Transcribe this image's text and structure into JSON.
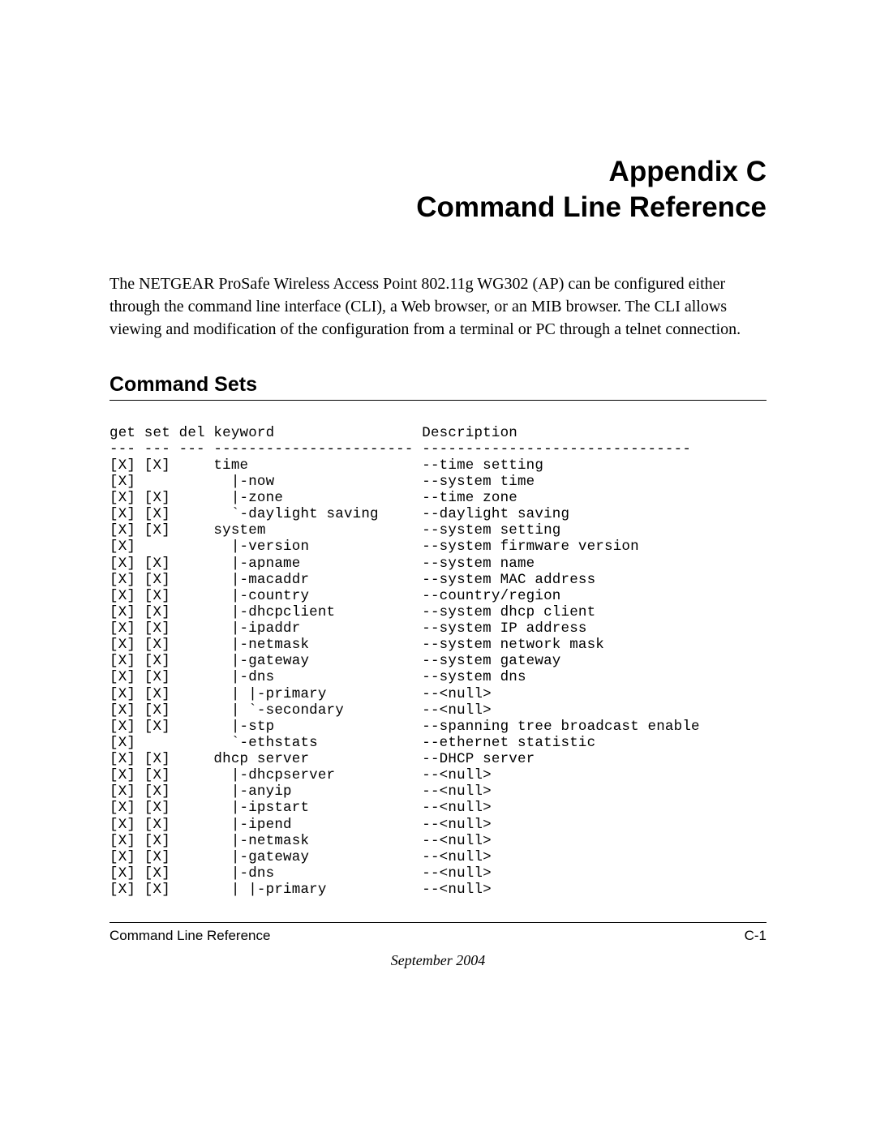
{
  "title_line1": "Appendix C",
  "title_line2": "Command Line Reference",
  "intro": "The NETGEAR ProSafe Wireless Access Point 802.11g WG302  (AP) can be configured either through the command line interface (CLI), a Web browser, or an MIB browser. The CLI allows viewing and modification of the configuration from a terminal or PC through a telnet connection.",
  "section_heading": "Command Sets",
  "footer_left": "Command Line Reference",
  "footer_right": "C-1",
  "footer_date": "September 2004",
  "table": {
    "header": {
      "get": "get",
      "set": "set",
      "del": "del",
      "keyword": "keyword",
      "description": "Description"
    },
    "divider": {
      "get": "---",
      "set": "---",
      "del": "---",
      "keyword": "-----------------------",
      "description": "-------------------------------"
    },
    "rows": [
      {
        "get": "[X]",
        "set": "[X]",
        "del": "",
        "keyword": "time",
        "description": "--time setting"
      },
      {
        "get": "[X]",
        "set": "",
        "del": "",
        "keyword": "  |-now",
        "description": "--system time"
      },
      {
        "get": "[X]",
        "set": "[X]",
        "del": "",
        "keyword": "  |-zone",
        "description": "--time zone"
      },
      {
        "get": "[X]",
        "set": "[X]",
        "del": "",
        "keyword": "  `-daylight saving",
        "description": "--daylight saving"
      },
      {
        "get": "[X]",
        "set": "[X]",
        "del": "",
        "keyword": "system",
        "description": "--system setting"
      },
      {
        "get": "[X]",
        "set": "",
        "del": "",
        "keyword": "  |-version",
        "description": "--system firmware version"
      },
      {
        "get": "[X]",
        "set": "[X]",
        "del": "",
        "keyword": "  |-apname",
        "description": "--system name"
      },
      {
        "get": "[X]",
        "set": "[X]",
        "del": "",
        "keyword": "  |-macaddr",
        "description": "--system MAC address"
      },
      {
        "get": "[X]",
        "set": "[X]",
        "del": "",
        "keyword": "  |-country",
        "description": "--country/region"
      },
      {
        "get": "[X]",
        "set": "[X]",
        "del": "",
        "keyword": "  |-dhcpclient",
        "description": "--system dhcp client"
      },
      {
        "get": "[X]",
        "set": "[X]",
        "del": "",
        "keyword": "  |-ipaddr",
        "description": "--system IP address"
      },
      {
        "get": "[X]",
        "set": "[X]",
        "del": "",
        "keyword": "  |-netmask",
        "description": "--system network mask"
      },
      {
        "get": "[X]",
        "set": "[X]",
        "del": "",
        "keyword": "  |-gateway",
        "description": "--system gateway"
      },
      {
        "get": "[X]",
        "set": "[X]",
        "del": "",
        "keyword": "  |-dns",
        "description": "--system dns"
      },
      {
        "get": "[X]",
        "set": "[X]",
        "del": "",
        "keyword": "  | |-primary",
        "description": "--<null>"
      },
      {
        "get": "[X]",
        "set": "[X]",
        "del": "",
        "keyword": "  | `-secondary",
        "description": "--<null>"
      },
      {
        "get": "[X]",
        "set": "[X]",
        "del": "",
        "keyword": "  |-stp",
        "description": "--spanning tree broadcast enable"
      },
      {
        "get": "[X]",
        "set": "",
        "del": "",
        "keyword": "  `-ethstats",
        "description": "--ethernet statistic"
      },
      {
        "get": "[X]",
        "set": "[X]",
        "del": "",
        "keyword": "dhcp server",
        "description": "--DHCP server"
      },
      {
        "get": "[X]",
        "set": "[X]",
        "del": "",
        "keyword": "  |-dhcpserver",
        "description": "--<null>"
      },
      {
        "get": "[X]",
        "set": "[X]",
        "del": "",
        "keyword": "  |-anyip",
        "description": "--<null>"
      },
      {
        "get": "[X]",
        "set": "[X]",
        "del": "",
        "keyword": "  |-ipstart",
        "description": "--<null>"
      },
      {
        "get": "[X]",
        "set": "[X]",
        "del": "",
        "keyword": "  |-ipend",
        "description": "--<null>"
      },
      {
        "get": "[X]",
        "set": "[X]",
        "del": "",
        "keyword": "  |-netmask",
        "description": "--<null>"
      },
      {
        "get": "[X]",
        "set": "[X]",
        "del": "",
        "keyword": "  |-gateway",
        "description": "--<null>"
      },
      {
        "get": "[X]",
        "set": "[X]",
        "del": "",
        "keyword": "  |-dns",
        "description": "--<null>"
      },
      {
        "get": "[X]",
        "set": "[X]",
        "del": "",
        "keyword": "  | |-primary",
        "description": "--<null>"
      }
    ],
    "col_widths": {
      "get": 4,
      "set": 4,
      "del": 4,
      "keyword": 24
    }
  }
}
